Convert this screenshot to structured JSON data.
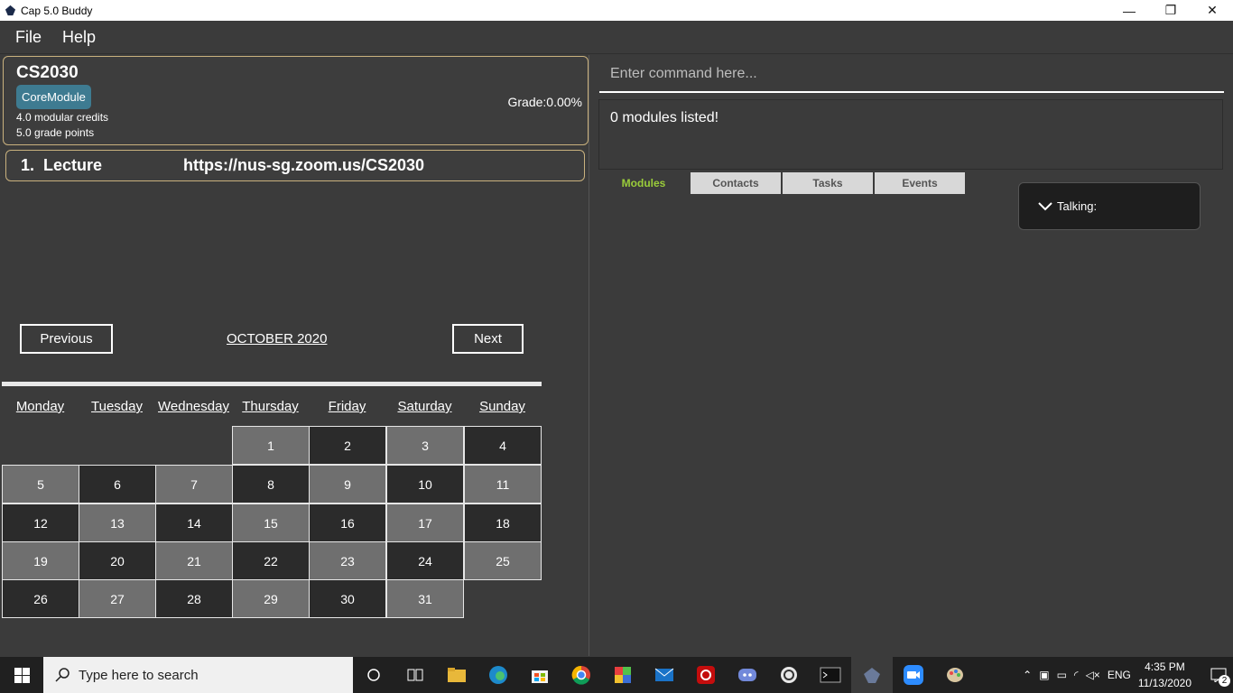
{
  "window": {
    "title": "Cap 5.0 Buddy",
    "minimize": "—",
    "restore": "❐",
    "close": "✕"
  },
  "menu": [
    "File",
    "Help"
  ],
  "module": {
    "code": "CS2030",
    "tag": "CoreModule",
    "credits": "4.0 modular credits",
    "grade_points": "5.0 grade points",
    "grade": "Grade:0.00%"
  },
  "zoom_link": {
    "index": "1.",
    "type": "Lecture",
    "url": "https://nus-sg.zoom.us/CS2030"
  },
  "calendar": {
    "prev_label": "Previous",
    "next_label": "Next",
    "month": "OCTOBER 2020",
    "weekdays": [
      "Monday",
      "Tuesday",
      "Wednesday",
      "Thursday",
      "Friday",
      "Saturday",
      "Sunday"
    ],
    "days": [
      "1",
      "2",
      "3",
      "4",
      "5",
      "6",
      "7",
      "8",
      "9",
      "10",
      "11",
      "12",
      "13",
      "14",
      "15",
      "16",
      "17",
      "18",
      "19",
      "20",
      "21",
      "22",
      "23",
      "24",
      "25",
      "26",
      "27",
      "28",
      "29",
      "30",
      "31"
    ]
  },
  "command": {
    "placeholder": "Enter command here..."
  },
  "result": "0 modules listed!",
  "tabs": [
    "Modules",
    "Contacts",
    "Tasks",
    "Events"
  ],
  "talking": "Talking:",
  "taskbar": {
    "search_placeholder": "Type here to search",
    "lang": "ENG",
    "time": "4:35 PM",
    "date": "11/13/2020",
    "notifications": "2"
  },
  "colors": {
    "background": "#3b3b3b",
    "card_border": "#c9b17e",
    "tag": "#3e7b91",
    "active_tab": "#9acd3a",
    "cell_dark": "#2b2b2b",
    "cell_light": "#6f6f6f"
  }
}
